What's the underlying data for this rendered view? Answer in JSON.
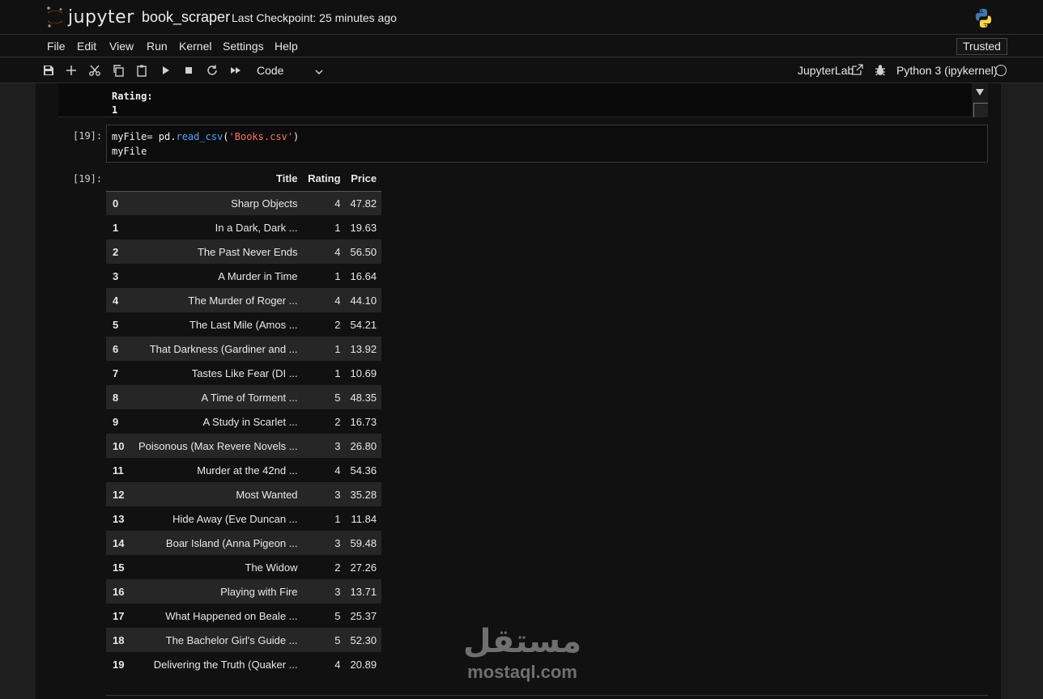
{
  "header": {
    "logo_text": "jupyter",
    "notebook_name": "book_scraper",
    "checkpoint": "Last Checkpoint: 25 minutes ago"
  },
  "menu": {
    "items": [
      "File",
      "Edit",
      "View",
      "Run",
      "Kernel",
      "Settings",
      "Help"
    ],
    "trusted": "Trusted"
  },
  "toolbar": {
    "icons": [
      "save-icon",
      "add-cell-icon",
      "cut-icon",
      "copy-icon",
      "paste-icon",
      "run-icon",
      "stop-icon",
      "restart-icon",
      "run-all-icon"
    ],
    "cell_type": "Code",
    "jupyterlab": "JupyterLab",
    "kernel": "Python 3 (ipykernel)"
  },
  "prev_output": {
    "line1": "Rating:",
    "line2": "1"
  },
  "input_cell": {
    "prompt": "[19]:",
    "code_part1": "myFile= pd.",
    "code_fn": "read_csv",
    "code_open": "(",
    "code_str": "'Books.csv'",
    "code_close": ")",
    "code_line2": "myFile"
  },
  "output_cell": {
    "prompt": "[19]:",
    "columns": [
      "",
      "Title",
      "Rating",
      "Price"
    ],
    "rows": [
      [
        "0",
        "Sharp Objects",
        "4",
        "47.82"
      ],
      [
        "1",
        "In a Dark, Dark ...",
        "1",
        "19.63"
      ],
      [
        "2",
        "The Past Never Ends",
        "4",
        "56.50"
      ],
      [
        "3",
        "A Murder in Time",
        "1",
        "16.64"
      ],
      [
        "4",
        "The Murder of Roger ...",
        "4",
        "44.10"
      ],
      [
        "5",
        "The Last Mile (Amos ...",
        "2",
        "54.21"
      ],
      [
        "6",
        "That Darkness (Gardiner and ...",
        "1",
        "13.92"
      ],
      [
        "7",
        "Tastes Like Fear (DI ...",
        "1",
        "10.69"
      ],
      [
        "8",
        "A Time of Torment ...",
        "5",
        "48.35"
      ],
      [
        "9",
        "A Study in Scarlet ...",
        "2",
        "16.73"
      ],
      [
        "10",
        "Poisonous (Max Revere Novels ...",
        "3",
        "26.80"
      ],
      [
        "11",
        "Murder at the 42nd ...",
        "4",
        "54.36"
      ],
      [
        "12",
        "Most Wanted",
        "3",
        "35.28"
      ],
      [
        "13",
        "Hide Away (Eve Duncan ...",
        "1",
        "11.84"
      ],
      [
        "14",
        "Boar Island (Anna Pigeon ...",
        "3",
        "59.48"
      ],
      [
        "15",
        "The Widow",
        "2",
        "27.26"
      ],
      [
        "16",
        "Playing with Fire",
        "3",
        "13.71"
      ],
      [
        "17",
        "What Happened on Beale ...",
        "5",
        "25.37"
      ],
      [
        "18",
        "The Bachelor Girl's Guide ...",
        "5",
        "52.30"
      ],
      [
        "19",
        "Delivering the Truth (Quaker ...",
        "4",
        "20.89"
      ]
    ]
  },
  "watermark": {
    "arabic": "مستقل",
    "latin": "mostaql.com"
  }
}
